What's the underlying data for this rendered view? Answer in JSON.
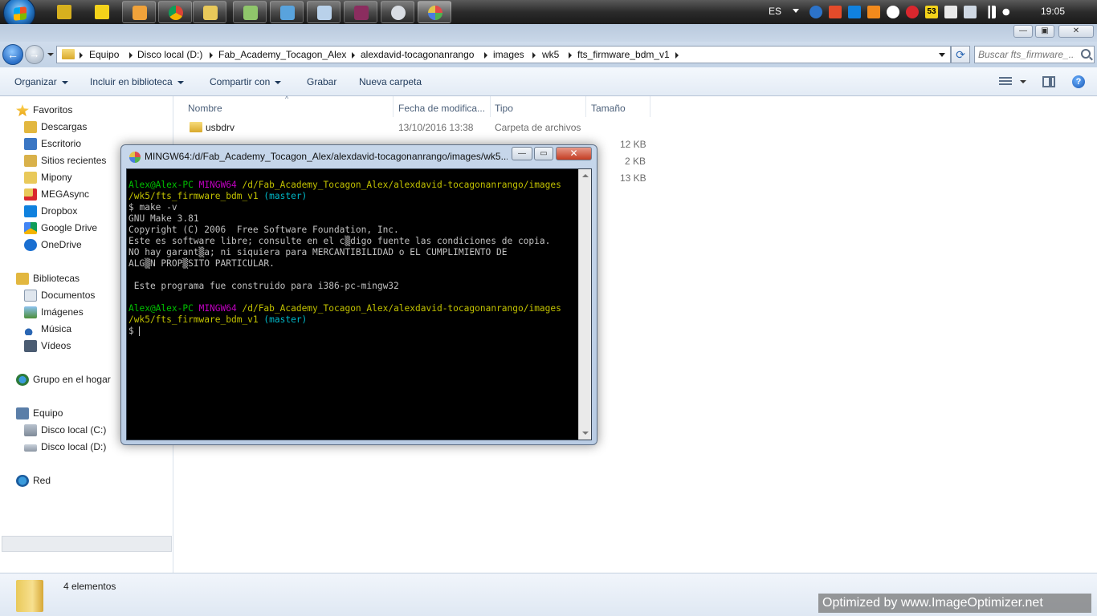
{
  "taskbar": {
    "lang": "ES",
    "clock": "19:05",
    "tray_badge": "53"
  },
  "explorer": {
    "address": {
      "crumbs": [
        "Equipo",
        "Disco local (D:)",
        "Fab_Academy_Tocagon_Alex",
        "alexdavid-tocagonanrango",
        "images",
        "wk5",
        "fts_firmware_bdm_v1"
      ]
    },
    "search_placeholder": "Buscar fts_firmware_...",
    "toolbar": {
      "organize": "Organizar",
      "include": "Incluir en biblioteca",
      "share": "Compartir con",
      "burn": "Grabar",
      "new_folder": "Nueva carpeta"
    },
    "nav": {
      "favorites": "Favoritos",
      "fav_items": [
        "Descargas",
        "Escritorio",
        "Sitios recientes",
        "Mipony",
        "MEGAsync",
        "Dropbox",
        "Google Drive",
        "OneDrive"
      ],
      "libraries": "Bibliotecas",
      "lib_items": [
        "Documentos",
        "Imágenes",
        "Música",
        "Vídeos"
      ],
      "homegroup": "Grupo en el hogar",
      "computer": "Equipo",
      "comp_items": [
        "Disco local (C:)",
        "Disco local (D:)"
      ],
      "network": "Red"
    },
    "columns": {
      "name": "Nombre",
      "date": "Fecha de modifica...",
      "type": "Tipo",
      "size": "Tamaño"
    },
    "files": [
      {
        "name": "usbdrv",
        "date": "13/10/2016 13:38",
        "type": "Carpeta de archivos",
        "size": ""
      },
      {
        "name": "",
        "date": "",
        "type": "",
        "size": "12 KB"
      },
      {
        "name": "",
        "date": "",
        "type": "",
        "size": "2 KB"
      },
      {
        "name": "",
        "date": "",
        "type": "",
        "size": "13 KB"
      }
    ],
    "status": "4 elementos"
  },
  "terminal": {
    "title": "MINGW64:/d/Fab_Academy_Tocagon_Alex/alexdavid-tocagonanrango/images/wk5...",
    "prompt_user": "Alex@Alex-PC",
    "prompt_env": "MINGW64",
    "prompt_path": "/d/Fab_Academy_Tocagon_Alex/alexdavid-tocagonanrango/images/wk5/fts_firmware_bdm_v1",
    "prompt_branch": "(master)",
    "command": "$ make -v",
    "output": [
      "GNU Make 3.81",
      "Copyright (C) 2006  Free Software Foundation, Inc.",
      "Este es software libre; consulte en el c▒digo fuente las condiciones de copia.",
      "NO hay garant▒a; ni siquiera para MERCANTIBILIDAD o EL CUMPLIMIENTO DE",
      "ALG▒N PROP▒SITO PARTICULAR.",
      "",
      " Este programa fue construido para i386-pc-mingw32"
    ],
    "prompt_line2": "$ "
  },
  "watermark": "Optimized by www.ImageOptimizer.net"
}
